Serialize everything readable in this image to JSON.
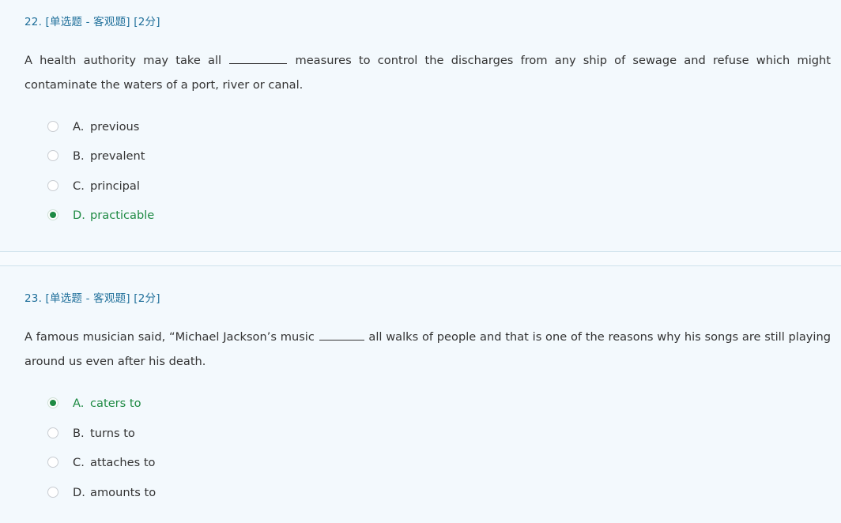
{
  "questions": [
    {
      "header": "22. [单选题 - 客观题] [2分]",
      "text_before": "A health authority may take all ",
      "text_after": " measures to control the discharges from any ship of sewage and refuse which might contaminate the waters of a port, river or canal.",
      "options": [
        {
          "letter": "A.",
          "text": "previous",
          "selected": false
        },
        {
          "letter": "B.",
          "text": "prevalent",
          "selected": false
        },
        {
          "letter": "C.",
          "text": "principal",
          "selected": false
        },
        {
          "letter": "D.",
          "text": "practicable",
          "selected": true
        }
      ]
    },
    {
      "header": "23. [单选题 - 客观题] [2分]",
      "text_before": "A famous musician said, “Michael Jackson’s music ",
      "text_after": " all walks of people and that is one of the reasons why his songs are still playing around us even after his death.",
      "options": [
        {
          "letter": "A.",
          "text": "caters to",
          "selected": true
        },
        {
          "letter": "B.",
          "text": "turns to",
          "selected": false
        },
        {
          "letter": "C.",
          "text": "attaches to",
          "selected": false
        },
        {
          "letter": "D.",
          "text": "amounts to",
          "selected": false
        }
      ]
    }
  ],
  "colors": {
    "header_blue": "#1f6f9a",
    "selected_green": "#1e8a43",
    "background": "#f3f9fd"
  }
}
